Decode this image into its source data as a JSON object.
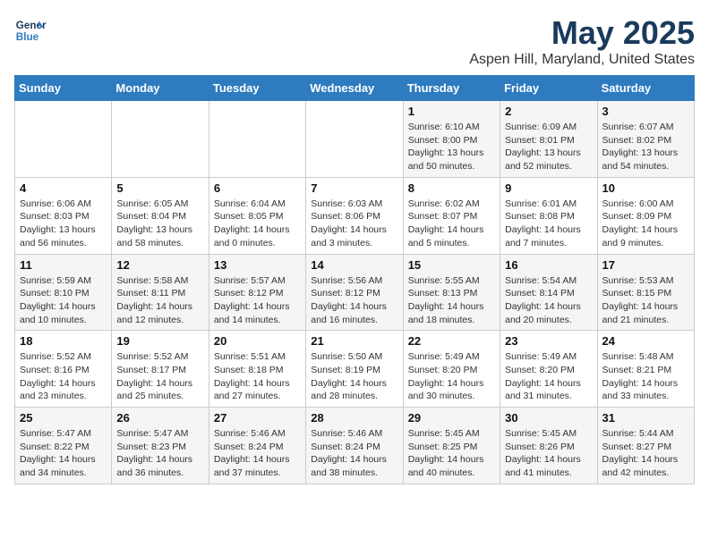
{
  "logo": {
    "line1": "General",
    "line2": "Blue"
  },
  "title": "May 2025",
  "location": "Aspen Hill, Maryland, United States",
  "days_of_week": [
    "Sunday",
    "Monday",
    "Tuesday",
    "Wednesday",
    "Thursday",
    "Friday",
    "Saturday"
  ],
  "weeks": [
    [
      {
        "day": "",
        "info": ""
      },
      {
        "day": "",
        "info": ""
      },
      {
        "day": "",
        "info": ""
      },
      {
        "day": "",
        "info": ""
      },
      {
        "day": "1",
        "info": "Sunrise: 6:10 AM\nSunset: 8:00 PM\nDaylight: 13 hours\nand 50 minutes."
      },
      {
        "day": "2",
        "info": "Sunrise: 6:09 AM\nSunset: 8:01 PM\nDaylight: 13 hours\nand 52 minutes."
      },
      {
        "day": "3",
        "info": "Sunrise: 6:07 AM\nSunset: 8:02 PM\nDaylight: 13 hours\nand 54 minutes."
      }
    ],
    [
      {
        "day": "4",
        "info": "Sunrise: 6:06 AM\nSunset: 8:03 PM\nDaylight: 13 hours\nand 56 minutes."
      },
      {
        "day": "5",
        "info": "Sunrise: 6:05 AM\nSunset: 8:04 PM\nDaylight: 13 hours\nand 58 minutes."
      },
      {
        "day": "6",
        "info": "Sunrise: 6:04 AM\nSunset: 8:05 PM\nDaylight: 14 hours\nand 0 minutes."
      },
      {
        "day": "7",
        "info": "Sunrise: 6:03 AM\nSunset: 8:06 PM\nDaylight: 14 hours\nand 3 minutes."
      },
      {
        "day": "8",
        "info": "Sunrise: 6:02 AM\nSunset: 8:07 PM\nDaylight: 14 hours\nand 5 minutes."
      },
      {
        "day": "9",
        "info": "Sunrise: 6:01 AM\nSunset: 8:08 PM\nDaylight: 14 hours\nand 7 minutes."
      },
      {
        "day": "10",
        "info": "Sunrise: 6:00 AM\nSunset: 8:09 PM\nDaylight: 14 hours\nand 9 minutes."
      }
    ],
    [
      {
        "day": "11",
        "info": "Sunrise: 5:59 AM\nSunset: 8:10 PM\nDaylight: 14 hours\nand 10 minutes."
      },
      {
        "day": "12",
        "info": "Sunrise: 5:58 AM\nSunset: 8:11 PM\nDaylight: 14 hours\nand 12 minutes."
      },
      {
        "day": "13",
        "info": "Sunrise: 5:57 AM\nSunset: 8:12 PM\nDaylight: 14 hours\nand 14 minutes."
      },
      {
        "day": "14",
        "info": "Sunrise: 5:56 AM\nSunset: 8:12 PM\nDaylight: 14 hours\nand 16 minutes."
      },
      {
        "day": "15",
        "info": "Sunrise: 5:55 AM\nSunset: 8:13 PM\nDaylight: 14 hours\nand 18 minutes."
      },
      {
        "day": "16",
        "info": "Sunrise: 5:54 AM\nSunset: 8:14 PM\nDaylight: 14 hours\nand 20 minutes."
      },
      {
        "day": "17",
        "info": "Sunrise: 5:53 AM\nSunset: 8:15 PM\nDaylight: 14 hours\nand 21 minutes."
      }
    ],
    [
      {
        "day": "18",
        "info": "Sunrise: 5:52 AM\nSunset: 8:16 PM\nDaylight: 14 hours\nand 23 minutes."
      },
      {
        "day": "19",
        "info": "Sunrise: 5:52 AM\nSunset: 8:17 PM\nDaylight: 14 hours\nand 25 minutes."
      },
      {
        "day": "20",
        "info": "Sunrise: 5:51 AM\nSunset: 8:18 PM\nDaylight: 14 hours\nand 27 minutes."
      },
      {
        "day": "21",
        "info": "Sunrise: 5:50 AM\nSunset: 8:19 PM\nDaylight: 14 hours\nand 28 minutes."
      },
      {
        "day": "22",
        "info": "Sunrise: 5:49 AM\nSunset: 8:20 PM\nDaylight: 14 hours\nand 30 minutes."
      },
      {
        "day": "23",
        "info": "Sunrise: 5:49 AM\nSunset: 8:20 PM\nDaylight: 14 hours\nand 31 minutes."
      },
      {
        "day": "24",
        "info": "Sunrise: 5:48 AM\nSunset: 8:21 PM\nDaylight: 14 hours\nand 33 minutes."
      }
    ],
    [
      {
        "day": "25",
        "info": "Sunrise: 5:47 AM\nSunset: 8:22 PM\nDaylight: 14 hours\nand 34 minutes."
      },
      {
        "day": "26",
        "info": "Sunrise: 5:47 AM\nSunset: 8:23 PM\nDaylight: 14 hours\nand 36 minutes."
      },
      {
        "day": "27",
        "info": "Sunrise: 5:46 AM\nSunset: 8:24 PM\nDaylight: 14 hours\nand 37 minutes."
      },
      {
        "day": "28",
        "info": "Sunrise: 5:46 AM\nSunset: 8:24 PM\nDaylight: 14 hours\nand 38 minutes."
      },
      {
        "day": "29",
        "info": "Sunrise: 5:45 AM\nSunset: 8:25 PM\nDaylight: 14 hours\nand 40 minutes."
      },
      {
        "day": "30",
        "info": "Sunrise: 5:45 AM\nSunset: 8:26 PM\nDaylight: 14 hours\nand 41 minutes."
      },
      {
        "day": "31",
        "info": "Sunrise: 5:44 AM\nSunset: 8:27 PM\nDaylight: 14 hours\nand 42 minutes."
      }
    ]
  ]
}
